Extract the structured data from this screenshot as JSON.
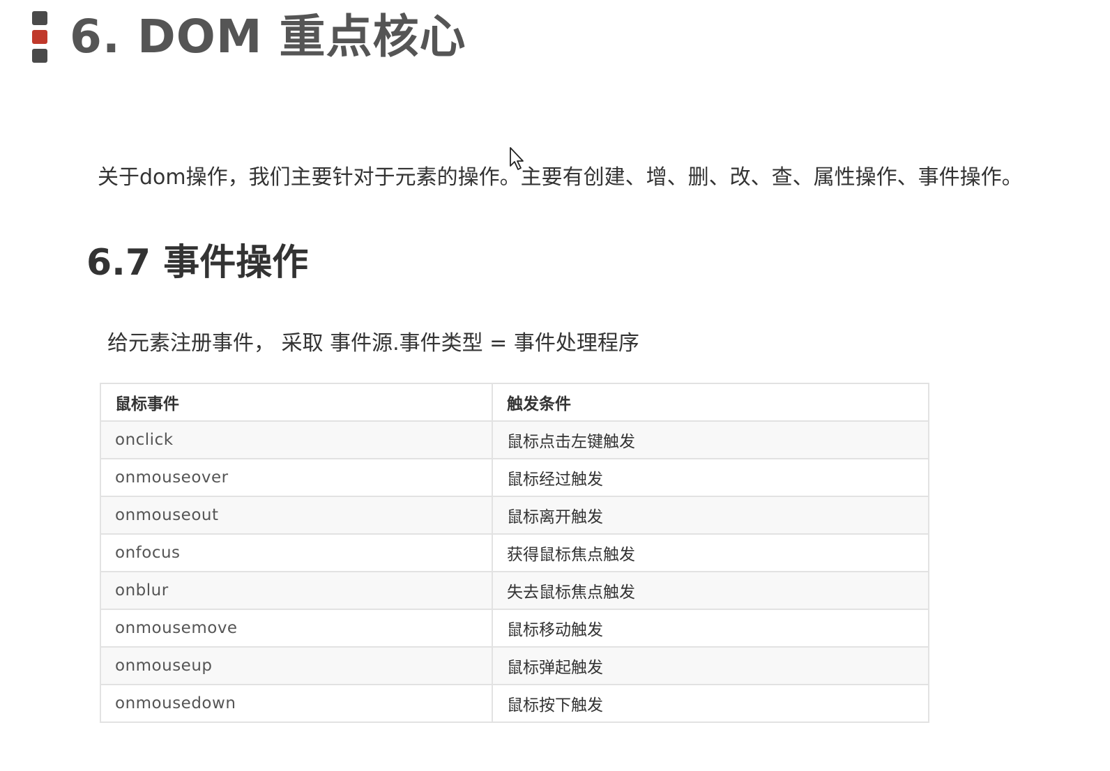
{
  "title": "6. DOM 重点核心",
  "intro": "关于dom操作，我们主要针对于元素的操作。主要有创建、增、删、改、查、属性操作、事件操作。",
  "section_title": "6.7 事件操作",
  "rule": "给元素注册事件， 采取  事件源.事件类型 = 事件处理程序",
  "table": {
    "headers": [
      "鼠标事件",
      "触发条件"
    ],
    "rows": [
      {
        "event": "onclick",
        "condition": "鼠标点击左键触发"
      },
      {
        "event": "onmouseover",
        "condition": "鼠标经过触发"
      },
      {
        "event": "onmouseout",
        "condition": "鼠标离开触发"
      },
      {
        "event": "onfocus",
        "condition": "获得鼠标焦点触发"
      },
      {
        "event": "onblur",
        "condition": "失去鼠标焦点触发"
      },
      {
        "event": "onmousemove",
        "condition": "鼠标移动触发"
      },
      {
        "event": "onmouseup",
        "condition": "鼠标弹起触发"
      },
      {
        "event": "onmousedown",
        "condition": "鼠标按下触发"
      }
    ]
  },
  "colors": {
    "accent": "#c0392b",
    "marker": "#4a4a4a",
    "title": "#555555",
    "border": "#e2e2e2"
  },
  "icons": {
    "title_marker": "title-marker-icon",
    "cursor": "mouse-pointer-icon"
  }
}
